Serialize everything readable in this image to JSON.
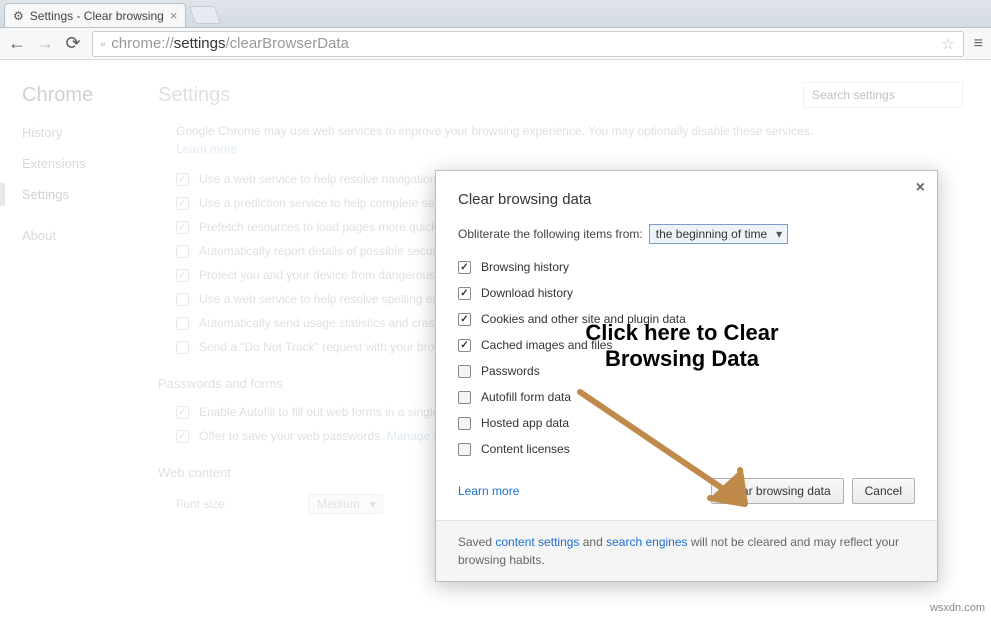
{
  "tab": {
    "title": "Settings - Clear browsing"
  },
  "url": {
    "prefix": "chrome://",
    "strong": "settings",
    "suffix": "/clearBrowserData"
  },
  "sidebar": {
    "brand": "Chrome",
    "items": [
      "History",
      "Extensions",
      "Settings"
    ],
    "about": "About"
  },
  "settings": {
    "heading": "Settings",
    "search_placeholder": "Search settings",
    "desc_a": "Google Chrome may use web services to improve your browsing experience. You may optionally disable these services. ",
    "desc_link": "Learn more",
    "checks": [
      {
        "c": true,
        "t": "Use a web service to help resolve navigation errors"
      },
      {
        "c": true,
        "t": "Use a prediction service to help complete searches and URLs typed in the address bar or the app launcher search box"
      },
      {
        "c": true,
        "t": "Prefetch resources to load pages more quickly"
      },
      {
        "c": false,
        "t": "Automatically report details of possible security incidents to Google"
      },
      {
        "c": true,
        "t": "Protect you and your device from dangerous sites"
      },
      {
        "c": false,
        "t": "Use a web service to help resolve spelling errors"
      },
      {
        "c": false,
        "t": "Automatically send usage statistics and crash reports to Google"
      },
      {
        "c": false,
        "t": "Send a \"Do Not Track\" request with your browsing traffic"
      }
    ],
    "pwd_heading": "Passwords and forms",
    "pwd_checks": [
      {
        "c": true,
        "t": "Enable Autofill to fill out web forms in a single click."
      },
      {
        "c": true,
        "t": "Offer to save your web passwords. "
      }
    ],
    "manage_link": "Manage passwords",
    "web_heading": "Web content",
    "font_label": "Font size:",
    "font_value": "Medium"
  },
  "dialog": {
    "title": "Clear browsing data",
    "obliterate": "Obliterate the following items from:",
    "time": "the beginning of time",
    "options": [
      {
        "c": true,
        "t": "Browsing history"
      },
      {
        "c": true,
        "t": "Download history"
      },
      {
        "c": true,
        "t": "Cookies and other site and plugin data"
      },
      {
        "c": true,
        "t": "Cached images and files"
      },
      {
        "c": false,
        "t": "Passwords"
      },
      {
        "c": false,
        "t": "Autofill form data"
      },
      {
        "c": false,
        "t": "Hosted app data"
      },
      {
        "c": false,
        "t": "Content licenses"
      }
    ],
    "learn": "Learn more",
    "clear_btn": "Clear browsing data",
    "cancel_btn": "Cancel",
    "footer_a": "Saved ",
    "footer_link1": "content settings",
    "footer_mid": " and ",
    "footer_link2": "search engines",
    "footer_b": " will not be cleared and may reflect your browsing habits."
  },
  "annotation": {
    "line1": "Click here to Clear",
    "line2": "Browsing Data"
  },
  "watermark": "wsxdn.com"
}
